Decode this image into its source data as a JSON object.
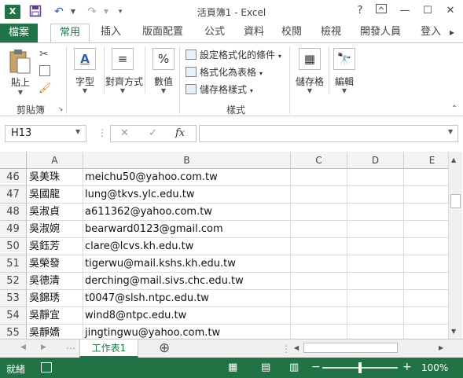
{
  "titlebar": {
    "app_title": "活頁簿1 - Excel",
    "logo": "X",
    "help": "?",
    "restore": "⧉",
    "minimize": "—",
    "maximize": "☐",
    "close": "✕"
  },
  "tabs": [
    "檔案",
    "常用",
    "插入",
    "版面配置",
    "公式",
    "資料",
    "校閱",
    "檢視",
    "開發人員",
    "登入"
  ],
  "ribbon": {
    "clipboard": {
      "paste": "貼上",
      "group": "剪貼簿"
    },
    "font": {
      "label": "字型"
    },
    "alignment": {
      "label": "對齊方式"
    },
    "number": {
      "label": "數值"
    },
    "styles": {
      "conditional": "設定格式化的條件",
      "format_table": "格式化為表格",
      "cell_styles": "儲存格樣式",
      "group": "樣式"
    },
    "cells": {
      "label": "儲存格"
    },
    "editing": {
      "label": "編輯"
    }
  },
  "formula_bar": {
    "name_box": "H13",
    "cancel": "✕",
    "enter": "✓",
    "fx": "fx",
    "value": ""
  },
  "grid": {
    "columns": [
      "A",
      "B",
      "C",
      "D",
      "E"
    ],
    "rows": [
      {
        "num": "46",
        "a": "吳美珠",
        "b": "meichu50@yahoo.com.tw"
      },
      {
        "num": "47",
        "a": "吳國龍",
        "b": "lung@tkvs.ylc.edu.tw"
      },
      {
        "num": "48",
        "a": "吳淑貞",
        "b": "a611362@yahoo.com.tw"
      },
      {
        "num": "49",
        "a": "吳淑婉",
        "b": "bearward0123@gmail.com"
      },
      {
        "num": "50",
        "a": "吳鈺芳",
        "b": "clare@lcvs.kh.edu.tw"
      },
      {
        "num": "51",
        "a": "吳榮發",
        "b": "tigerwu@mail.kshs.kh.edu.tw"
      },
      {
        "num": "52",
        "a": "吳德清",
        "b": "derching@mail.sivs.chc.edu.tw"
      },
      {
        "num": "53",
        "a": "吳錦琇",
        "b": "t0047@slsh.ntpc.edu.tw"
      },
      {
        "num": "54",
        "a": "吳靜宜",
        "b": "wind8@ntpc.edu.tw"
      },
      {
        "num": "55",
        "a": "吳靜嬌",
        "b": "jingtingwu@yahoo.com.tw"
      }
    ]
  },
  "sheets": {
    "active": "工作表1",
    "add": "⊕"
  },
  "status": {
    "mode": "就緒",
    "zoom": "100%",
    "zoom_out": "−",
    "zoom_in": "+"
  },
  "colors": {
    "excel_green": "#217346"
  }
}
